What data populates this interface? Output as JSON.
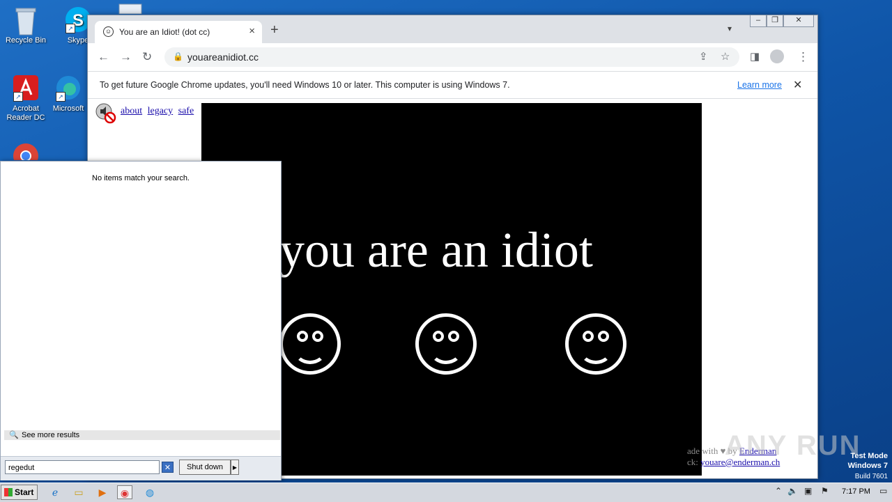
{
  "desktop": {
    "icons": [
      {
        "label": "Recycle Bin"
      },
      {
        "label": "Skype"
      },
      {
        "label": "Acrobat Reader DC"
      },
      {
        "label": "Microsoft"
      }
    ]
  },
  "browser": {
    "tab": {
      "title": "You are an Idiot! (dot cc)"
    },
    "address": {
      "url": "youareanidiot.cc"
    },
    "infobar": {
      "message": "To get future Google Chrome updates, you'll need Windows 10 or later. This computer is using Windows 7.",
      "learn_more": "Learn more"
    },
    "page": {
      "links": [
        "about",
        "legacy",
        "safe"
      ],
      "headline": "you are an idiot",
      "footer_made": "ade with",
      "footer_by": "by",
      "footer_author": "Enderman",
      "footer_contact_prefix": "ck:",
      "footer_email": "youare@enderman.ch"
    }
  },
  "start_menu": {
    "no_results": "No items match your search.",
    "see_more": "See more results",
    "search_value": "regedut",
    "shutdown_label": "Shut down"
  },
  "taskbar": {
    "start_label": "Start",
    "clock": "7:17 PM"
  },
  "watermark": {
    "line1": "Test Mode",
    "line2": "Windows 7",
    "line3": "Build 7601",
    "brand": "ANY RUN"
  }
}
